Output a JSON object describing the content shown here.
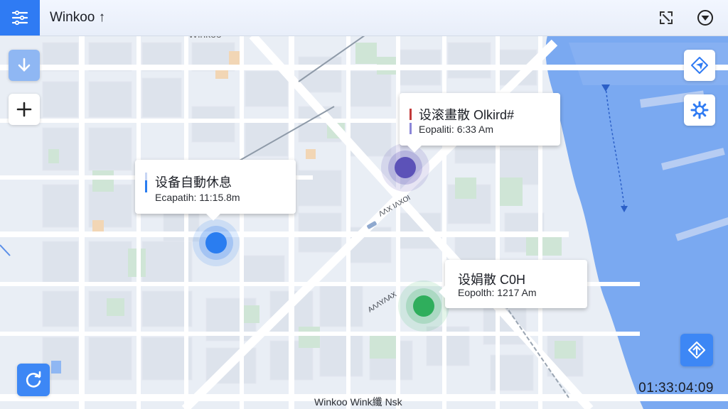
{
  "app": {
    "title": "Winkoo ↑",
    "faded_label": "Winkoo",
    "footer_label": "Winkoo Wink纖 Nsk",
    "clock": "01:33:04:09"
  },
  "colors": {
    "accent": "#2f7bf3",
    "water": "#7aa9f1",
    "marker_blue": "#2a7df0",
    "marker_purple": "#5c52b8",
    "marker_green": "#2fae5c"
  },
  "markers": [
    {
      "name": "marker-1",
      "title": "设备自動休息",
      "sub": "Ecapatih: 11:15.8m",
      "color": "#2a7df0"
    },
    {
      "name": "marker-2",
      "title": "设滚畫散 Olkird#",
      "sub": "Eopaliti: 6:33 Am",
      "color": "#5c52b8"
    },
    {
      "name": "marker-3",
      "title": "设娟散 C0H",
      "sub": "Eopolth: 1217 Am",
      "color": "#2fae5c"
    }
  ],
  "map_labels": {
    "street": "ΛΛΧ ΙΛΧΟΙ",
    "street2": "ΑΛΛΥΛΑΧ"
  },
  "icons": {
    "menu": "menu-icon",
    "expand": "expand-icon",
    "filter": "filter-icon",
    "down": "arrow-down-icon",
    "plus": "plus-icon",
    "location": "location-icon",
    "settings": "gear-icon",
    "refresh": "refresh-icon",
    "navigate": "navigate-icon"
  }
}
